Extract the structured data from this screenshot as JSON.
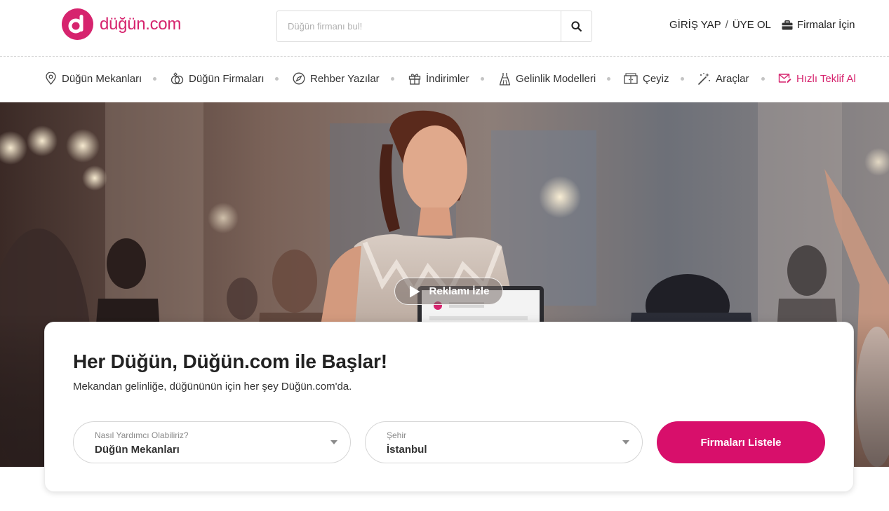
{
  "header": {
    "logo_letter": "d",
    "logo_text": "düğün.com",
    "search_placeholder": "Düğün firmanı bul!",
    "login": "GİRİŞ YAP",
    "separator": "/",
    "signup": "ÜYE OL",
    "for_firms": "Firmalar İçin"
  },
  "nav": {
    "items": [
      {
        "label": "Düğün Mekanları",
        "icon": "location-pin-icon"
      },
      {
        "label": "Düğün Firmaları",
        "icon": "rings-icon"
      },
      {
        "label": "Rehber Yazılar",
        "icon": "compass-icon"
      },
      {
        "label": "İndirimler",
        "icon": "gift-icon"
      },
      {
        "label": "Gelinlik Modelleri",
        "icon": "dress-icon"
      },
      {
        "label": "Çeyiz",
        "icon": "cabinet-icon"
      },
      {
        "label": "Araçlar",
        "icon": "magic-wand-icon"
      },
      {
        "label": "Hızlı Teklif Al",
        "icon": "mail-edit-icon"
      }
    ]
  },
  "hero": {
    "watch_label": "Reklamı İzle"
  },
  "finder": {
    "title": "Her Düğün, Düğün.com ile Başlar!",
    "subtitle": "Mekandan gelinliğe, düğününün için her şey Düğün.com'da.",
    "category_label": "Nasıl Yardımcı Olabiliriz?",
    "category_value": "Düğün Mekanları",
    "city_label": "Şehir",
    "city_value": "İstanbul",
    "submit_label": "Firmaları Listele"
  },
  "colors": {
    "brand": "#d6246e",
    "button": "#d80f6b"
  }
}
